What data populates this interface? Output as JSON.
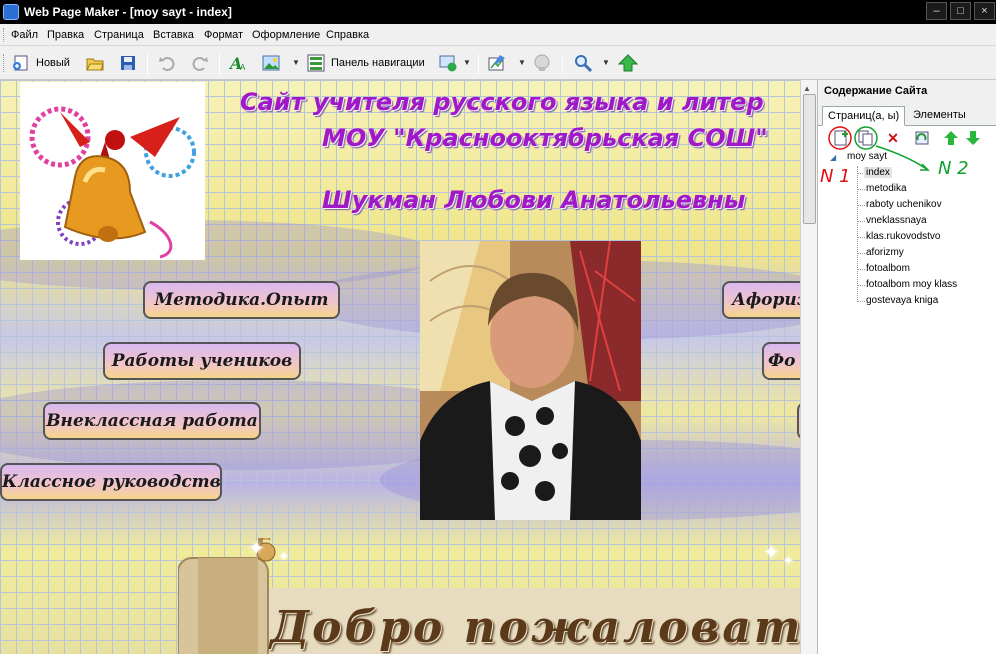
{
  "window": {
    "title": "Web Page Maker - [moy sayt - index]"
  },
  "menu": [
    "Файл",
    "Правка",
    "Страница",
    "Вставка",
    "Формат",
    "Оформление",
    "Справка"
  ],
  "toolbar": {
    "new_label": "Новый",
    "nav_panel_label": "Панель навигации"
  },
  "site": {
    "title_line1": "Сайт учителя русского языка и литер",
    "title_line2": "МОУ \"Краснооктябрьская СОШ\"",
    "title_line3": "Шукман Любови Анатольевны",
    "nav_buttons": [
      "Методика.Опыт",
      "Работы учеников",
      "Внеклассная работа",
      "Классное руководство",
      "Афориз",
      "Фо"
    ],
    "banner_text": "Добро пожаловать!"
  },
  "panel": {
    "header": "Содержание Сайта",
    "tab_pages": "Страниц(а, ы)",
    "tab_elements": "Элементы",
    "tree_root": "moy sayt",
    "pages": [
      "index",
      "metodika",
      "raboty uchenikov",
      "vneklassnaya",
      "klas.rukovodstvo",
      "aforizmy",
      "fotoalbom",
      "fotoalbom moy klass",
      "gostevaya kniga"
    ],
    "annotation1": "N 1",
    "annotation2": "N 2"
  },
  "colors": {
    "title_purple": "#a018c8",
    "annotation_red": "#e01010",
    "annotation_green": "#10a030"
  }
}
